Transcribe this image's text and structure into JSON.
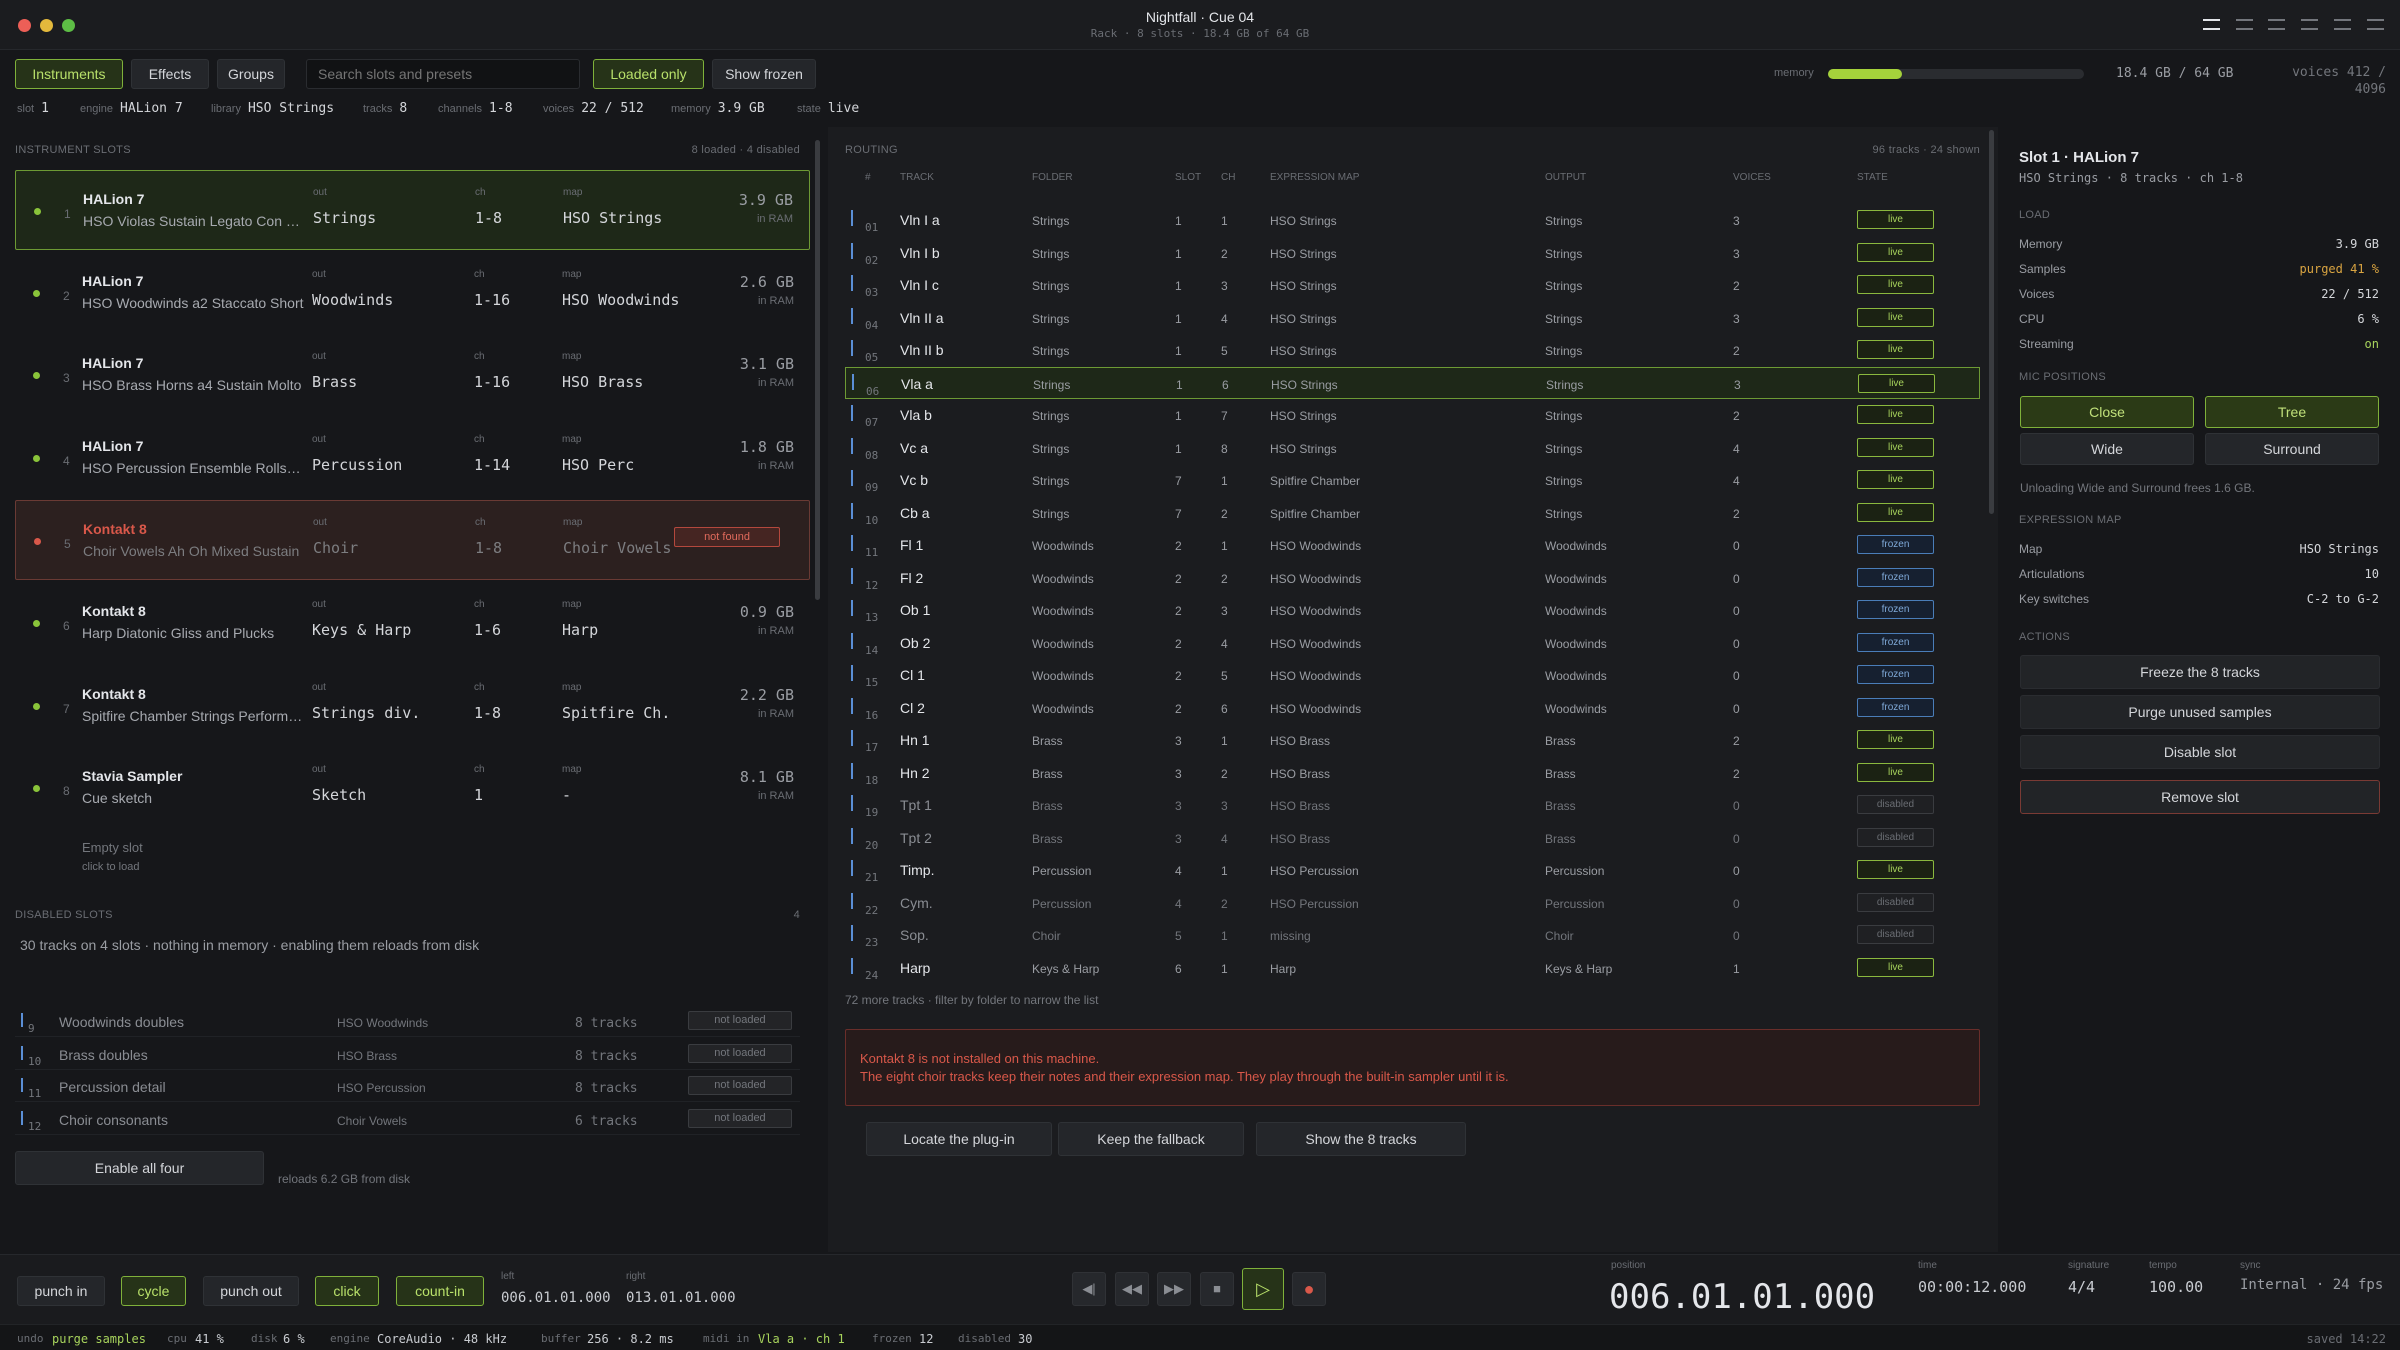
{
  "window": {
    "title": "Nightfall · Cue 04",
    "subtitle": "Rack · 8 slots · 18.4 GB of 64 GB"
  },
  "toolbar": {
    "tabs": [
      "Instruments",
      "Effects",
      "Groups"
    ],
    "search_placeholder": "Search slots and presets",
    "loaded_only": "Loaded only",
    "show_frozen": "Show frozen",
    "memory_label": "memory",
    "memory_fraction": 0.29,
    "memory_text": "18.4 GB / 64 GB",
    "voices_line1": "voices 412 /",
    "voices_line2": "4096"
  },
  "info": [
    {
      "k": "slot",
      "v": "1"
    },
    {
      "k": "engine",
      "v": "HALion 7"
    },
    {
      "k": "library",
      "v": "HSO Strings"
    },
    {
      "k": "tracks",
      "v": "8"
    },
    {
      "k": "channels",
      "v": "1-8"
    },
    {
      "k": "voices",
      "v": "22 / 512"
    },
    {
      "k": "memory",
      "v": "3.9 GB"
    },
    {
      "k": "state",
      "v": "live"
    }
  ],
  "slots_panel": {
    "heading": "INSTRUMENT SLOTS",
    "summary": "8 loaded · 4 disabled",
    "col_out": "out",
    "col_ch": "ch",
    "col_map": "map",
    "in_ram": "in RAM",
    "slots": [
      {
        "n": "1",
        "engine": "HALion 7",
        "preset": "HSO Violas Sustain Legato Con Sordino",
        "out": "Strings",
        "ch": "1-8",
        "map": "HSO Strings",
        "mem": "3.9 GB",
        "state": "selected"
      },
      {
        "n": "2",
        "engine": "HALion 7",
        "preset": "HSO Woodwinds a2 Staccato Short",
        "out": "Woodwinds",
        "ch": "1-16",
        "map": "HSO Woodwinds",
        "mem": "2.6 GB",
        "state": "ok"
      },
      {
        "n": "3",
        "engine": "HALion 7",
        "preset": "HSO Brass Horns a4 Sustain Molto",
        "out": "Brass",
        "ch": "1-16",
        "map": "HSO Brass",
        "mem": "3.1 GB",
        "state": "ok"
      },
      {
        "n": "4",
        "engine": "HALion 7",
        "preset": "HSO Percussion Ensemble Rolls and Hits",
        "out": "Percussion",
        "ch": "1-14",
        "map": "HSO Perc",
        "mem": "1.8 GB",
        "state": "ok"
      },
      {
        "n": "5",
        "engine": "Kontakt 8",
        "preset": "Choir Vowels Ah Oh Mixed Sustain",
        "out": "Choir",
        "ch": "1-8",
        "map": "Choir Vowels",
        "mem": "",
        "state": "error",
        "badge": "not found"
      },
      {
        "n": "6",
        "engine": "Kontakt 8",
        "preset": "Harp Diatonic Gliss and Plucks",
        "out": "Keys & Harp",
        "ch": "1-6",
        "map": "Harp",
        "mem": "0.9 GB",
        "state": "ok"
      },
      {
        "n": "7",
        "engine": "Kontakt 8",
        "preset": "Spitfire Chamber Strings Performance",
        "out": "Strings div.",
        "ch": "1-8",
        "map": "Spitfire Ch.",
        "mem": "2.2 GB",
        "state": "ok"
      },
      {
        "n": "8",
        "engine": "Stavia Sampler",
        "preset": "Cue sketch",
        "out": "Sketch",
        "ch": "1",
        "map": "-",
        "mem": "8.1 GB",
        "state": "ok"
      }
    ],
    "empty_title": "Empty slot",
    "empty_sub": "click to load"
  },
  "disabled": {
    "heading": "DISABLED SLOTS",
    "count": "4",
    "desc": "30 tracks on 4 slots · nothing in memory · enabling them reloads from disk",
    "rows": [
      {
        "n": "9",
        "name": "Woodwinds doubles",
        "map": "HSO Woodwinds",
        "tracks": "8 tracks",
        "badge": "not loaded"
      },
      {
        "n": "10",
        "name": "Brass doubles",
        "map": "HSO Brass",
        "tracks": "8 tracks",
        "badge": "not loaded"
      },
      {
        "n": "11",
        "name": "Percussion detail",
        "map": "HSO Percussion",
        "tracks": "8 tracks",
        "badge": "not loaded"
      },
      {
        "n": "12",
        "name": "Choir consonants",
        "map": "Choir Vowels",
        "tracks": "6 tracks",
        "badge": "not loaded"
      }
    ],
    "enable_label": "Enable all four",
    "enable_note": "reloads 6.2 GB from disk"
  },
  "routing": {
    "heading": "ROUTING",
    "summary": "96 tracks · 24 shown",
    "cols": [
      "#",
      "TRACK",
      "FOLDER",
      "SLOT",
      "CH",
      "EXPRESSION MAP",
      "OUTPUT",
      "VOICES",
      "STATE"
    ],
    "rows": [
      [
        "01",
        "Vln I a",
        "Strings",
        "1",
        "1",
        "HSO Strings",
        "Strings",
        "3",
        "live"
      ],
      [
        "02",
        "Vln I b",
        "Strings",
        "1",
        "2",
        "HSO Strings",
        "Strings",
        "3",
        "live"
      ],
      [
        "03",
        "Vln I c",
        "Strings",
        "1",
        "3",
        "HSO Strings",
        "Strings",
        "2",
        "live"
      ],
      [
        "04",
        "Vln II a",
        "Strings",
        "1",
        "4",
        "HSO Strings",
        "Strings",
        "3",
        "live"
      ],
      [
        "05",
        "Vln II b",
        "Strings",
        "1",
        "5",
        "HSO Strings",
        "Strings",
        "2",
        "live"
      ],
      [
        "06",
        "Vla a",
        "Strings",
        "1",
        "6",
        "HSO Strings",
        "Strings",
        "3",
        "live"
      ],
      [
        "07",
        "Vla b",
        "Strings",
        "1",
        "7",
        "HSO Strings",
        "Strings",
        "2",
        "live"
      ],
      [
        "08",
        "Vc a",
        "Strings",
        "1",
        "8",
        "HSO Strings",
        "Strings",
        "4",
        "live"
      ],
      [
        "09",
        "Vc b",
        "Strings",
        "7",
        "1",
        "Spitfire Chamber",
        "Strings",
        "4",
        "live"
      ],
      [
        "10",
        "Cb a",
        "Strings",
        "7",
        "2",
        "Spitfire Chamber",
        "Strings",
        "2",
        "live"
      ],
      [
        "11",
        "Fl 1",
        "Woodwinds",
        "2",
        "1",
        "HSO Woodwinds",
        "Woodwinds",
        "0",
        "frozen"
      ],
      [
        "12",
        "Fl 2",
        "Woodwinds",
        "2",
        "2",
        "HSO Woodwinds",
        "Woodwinds",
        "0",
        "frozen"
      ],
      [
        "13",
        "Ob 1",
        "Woodwinds",
        "2",
        "3",
        "HSO Woodwinds",
        "Woodwinds",
        "0",
        "frozen"
      ],
      [
        "14",
        "Ob 2",
        "Woodwinds",
        "2",
        "4",
        "HSO Woodwinds",
        "Woodwinds",
        "0",
        "frozen"
      ],
      [
        "15",
        "Cl 1",
        "Woodwinds",
        "2",
        "5",
        "HSO Woodwinds",
        "Woodwinds",
        "0",
        "frozen"
      ],
      [
        "16",
        "Cl 2",
        "Woodwinds",
        "2",
        "6",
        "HSO Woodwinds",
        "Woodwinds",
        "0",
        "frozen"
      ],
      [
        "17",
        "Hn 1",
        "Brass",
        "3",
        "1",
        "HSO Brass",
        "Brass",
        "2",
        "live"
      ],
      [
        "18",
        "Hn 2",
        "Brass",
        "3",
        "2",
        "HSO Brass",
        "Brass",
        "2",
        "live"
      ],
      [
        "19",
        "Tpt 1",
        "Brass",
        "3",
        "3",
        "HSO Brass",
        "Brass",
        "0",
        "disabled"
      ],
      [
        "20",
        "Tpt 2",
        "Brass",
        "3",
        "4",
        "HSO Brass",
        "Brass",
        "0",
        "disabled"
      ],
      [
        "21",
        "Timp.",
        "Percussion",
        "4",
        "1",
        "HSO Percussion",
        "Percussion",
        "0",
        "live"
      ],
      [
        "22",
        "Cym.",
        "Percussion",
        "4",
        "2",
        "HSO Percussion",
        "Percussion",
        "0",
        "disabled"
      ],
      [
        "23",
        "Sop.",
        "Choir",
        "5",
        "1",
        "missing",
        "Choir",
        "0",
        "disabled"
      ],
      [
        "24",
        "Harp",
        "Keys & Harp",
        "6",
        "1",
        "Harp",
        "Keys & Harp",
        "1",
        "live"
      ]
    ],
    "more": "72 more tracks · filter by folder to narrow the list"
  },
  "alert": {
    "line1": "Kontakt 8 is not installed on this machine.",
    "line2": "The eight choir tracks keep their notes and their expression map. They play through the built-in sampler until it is.",
    "buttons": [
      "Locate the plug-in",
      "Keep the fallback",
      "Show the 8 tracks"
    ]
  },
  "inspector": {
    "title": "Slot 1 · HALion 7",
    "subtitle": "HSO Strings · 8 tracks · ch 1-8",
    "load_heading": "LOAD",
    "load": [
      {
        "k": "Memory",
        "v": "3.9 GB"
      },
      {
        "k": "Samples",
        "v": "purged 41 %"
      },
      {
        "k": "Voices",
        "v": "22 / 512"
      },
      {
        "k": "CPU",
        "v": "6 %"
      },
      {
        "k": "Streaming",
        "v": "on"
      }
    ],
    "mic_heading": "MIC POSITIONS",
    "mics": [
      "Close",
      "Tree",
      "Wide",
      "Surround"
    ],
    "mic_note": "Unloading Wide and Surround frees 1.6 GB.",
    "map_heading": "EXPRESSION MAP",
    "map": [
      {
        "k": "Map",
        "v": "HSO Strings"
      },
      {
        "k": "Articulations",
        "v": "10"
      },
      {
        "k": "Key switches",
        "v": "C-2 to G-2"
      }
    ],
    "actions_heading": "ACTIONS",
    "actions": [
      "Freeze the 8 tracks",
      "Purge unused samples",
      "Disable slot",
      "Remove slot"
    ]
  },
  "transport": {
    "punch_in": "punch in",
    "cycle": "cycle",
    "punch_out": "punch out",
    "click": "click",
    "count_in": "count-in",
    "left_label": "left",
    "left": "006.01.01.000",
    "right_label": "right",
    "right": "013.01.01.000",
    "position_label": "position",
    "position": "006.01.01.000",
    "time_label": "time",
    "time": "00:00:12.000",
    "signature_label": "signature",
    "signature": "4/4",
    "tempo_label": "tempo",
    "tempo": "100.00",
    "sync_label": "sync",
    "sync": "Internal · 24 fps"
  },
  "status": {
    "undo_k": "undo",
    "undo_v": "purge samples",
    "cpu_k": "cpu",
    "cpu_v": "41 %",
    "disk_k": "disk",
    "disk_v": "6 %",
    "engine_k": "engine",
    "engine_v": "CoreAudio · 48 kHz",
    "buffer_k": "buffer",
    "buffer_v": "256 · 8.2 ms",
    "midi_k": "midi in",
    "midi_v": "Vla a · ch 1",
    "frozen_k": "frozen",
    "frozen_v": "12",
    "disabled_k": "disabled",
    "disabled_v": "30",
    "saved": "saved 14:22"
  },
  "colors": {
    "accent": "#a5d23b",
    "error": "#d9584a",
    "frozen": "#5b8fd6"
  }
}
